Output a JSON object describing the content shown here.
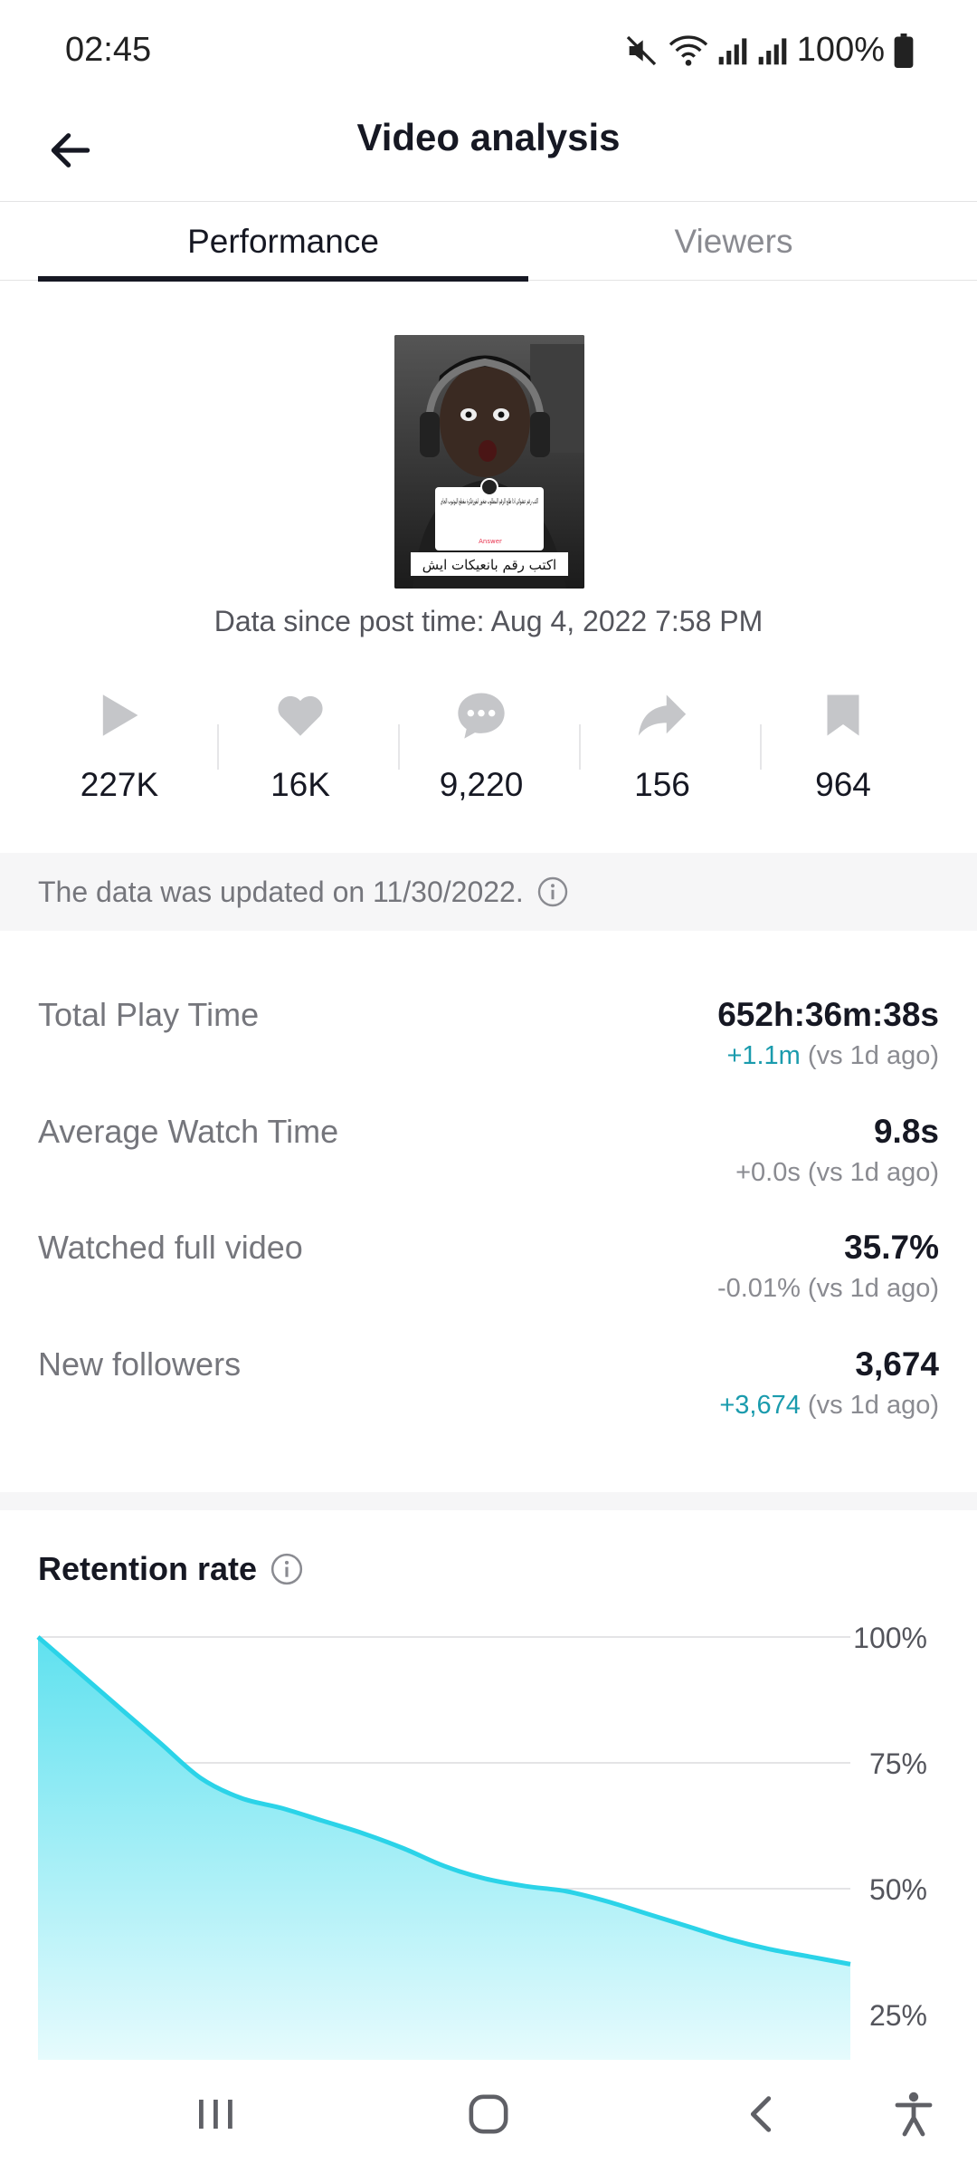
{
  "status_bar": {
    "time": "02:45",
    "battery": "100%",
    "icons": [
      "mute-icon",
      "wifi-icon",
      "signal-icon",
      "signal-icon",
      "battery-icon"
    ]
  },
  "header": {
    "title": "Video analysis",
    "back_icon": "arrow-left-icon"
  },
  "tabs": [
    {
      "label": "Performance",
      "active": true
    },
    {
      "label": "Viewers",
      "active": false
    }
  ],
  "video": {
    "post_time_text": "Data since post time: Aug 4, 2022 7:58 PM",
    "thumbnail_caption": "اكتب رقم بانعيكات ايش",
    "thumbnail_card_text": "اكتب رقم عشوائي اذا طلع الرقم المطلوب ضغوز ابقوزفكرة مقطع اليوتيوب الجاي",
    "thumbnail_answer_label": "Answer"
  },
  "stats": [
    {
      "icon": "play-icon",
      "value": "227K"
    },
    {
      "icon": "heart-icon",
      "value": "16K"
    },
    {
      "icon": "comment-icon",
      "value": "9,220"
    },
    {
      "icon": "share-icon",
      "value": "156"
    },
    {
      "icon": "bookmark-icon",
      "value": "964"
    }
  ],
  "update_notice": "The data was updated on 11/30/2022.",
  "metrics": [
    {
      "label": "Total Play Time",
      "value": "652h:36m:38s",
      "delta": "+1.1m",
      "compare": "(vs 1d ago)",
      "delta_color": "#1a9bad"
    },
    {
      "label": "Average Watch Time",
      "value": "9.8s",
      "delta": "+0.0s",
      "compare": "(vs 1d ago)",
      "delta_color": "#8a8b91"
    },
    {
      "label": "Watched full video",
      "value": "35.7%",
      "delta": "-0.01%",
      "compare": "(vs 1d ago)",
      "delta_color": "#8a8b91"
    },
    {
      "label": "New followers",
      "value": "3,674",
      "delta": "+3,674",
      "compare": "(vs 1d ago)",
      "delta_color": "#1a9bad"
    }
  ],
  "retention": {
    "title": "Retention rate"
  },
  "chart_data": {
    "type": "area",
    "title": "Retention rate",
    "x": [
      0,
      0.05,
      0.1,
      0.15,
      0.2,
      0.25,
      0.3,
      0.35,
      0.4,
      0.45,
      0.5,
      0.55,
      0.6,
      0.65,
      0.7,
      0.75,
      0.8,
      0.85,
      0.9,
      0.95,
      1.0
    ],
    "series": [
      {
        "values": [
          100,
          93,
          86,
          79,
          72,
          68,
          66,
          63.5,
          61,
          58,
          54.5,
          52,
          50.5,
          49.5,
          47.5,
          45,
          42.5,
          40,
          38,
          36.5,
          35
        ]
      }
    ],
    "yticks": [
      "100%",
      "75%",
      "50%",
      "25%"
    ],
    "ytick_values": [
      100,
      75,
      50,
      25
    ],
    "ylim": [
      16,
      100
    ],
    "grid": true,
    "colors": {
      "line": "#2bd3e8",
      "fill_top": "#5fe1ef",
      "fill_bottom": "#e6fbfd"
    }
  },
  "nav_bar": [
    "recent-apps-icon",
    "home-icon",
    "back-icon",
    "accessibility-icon"
  ]
}
